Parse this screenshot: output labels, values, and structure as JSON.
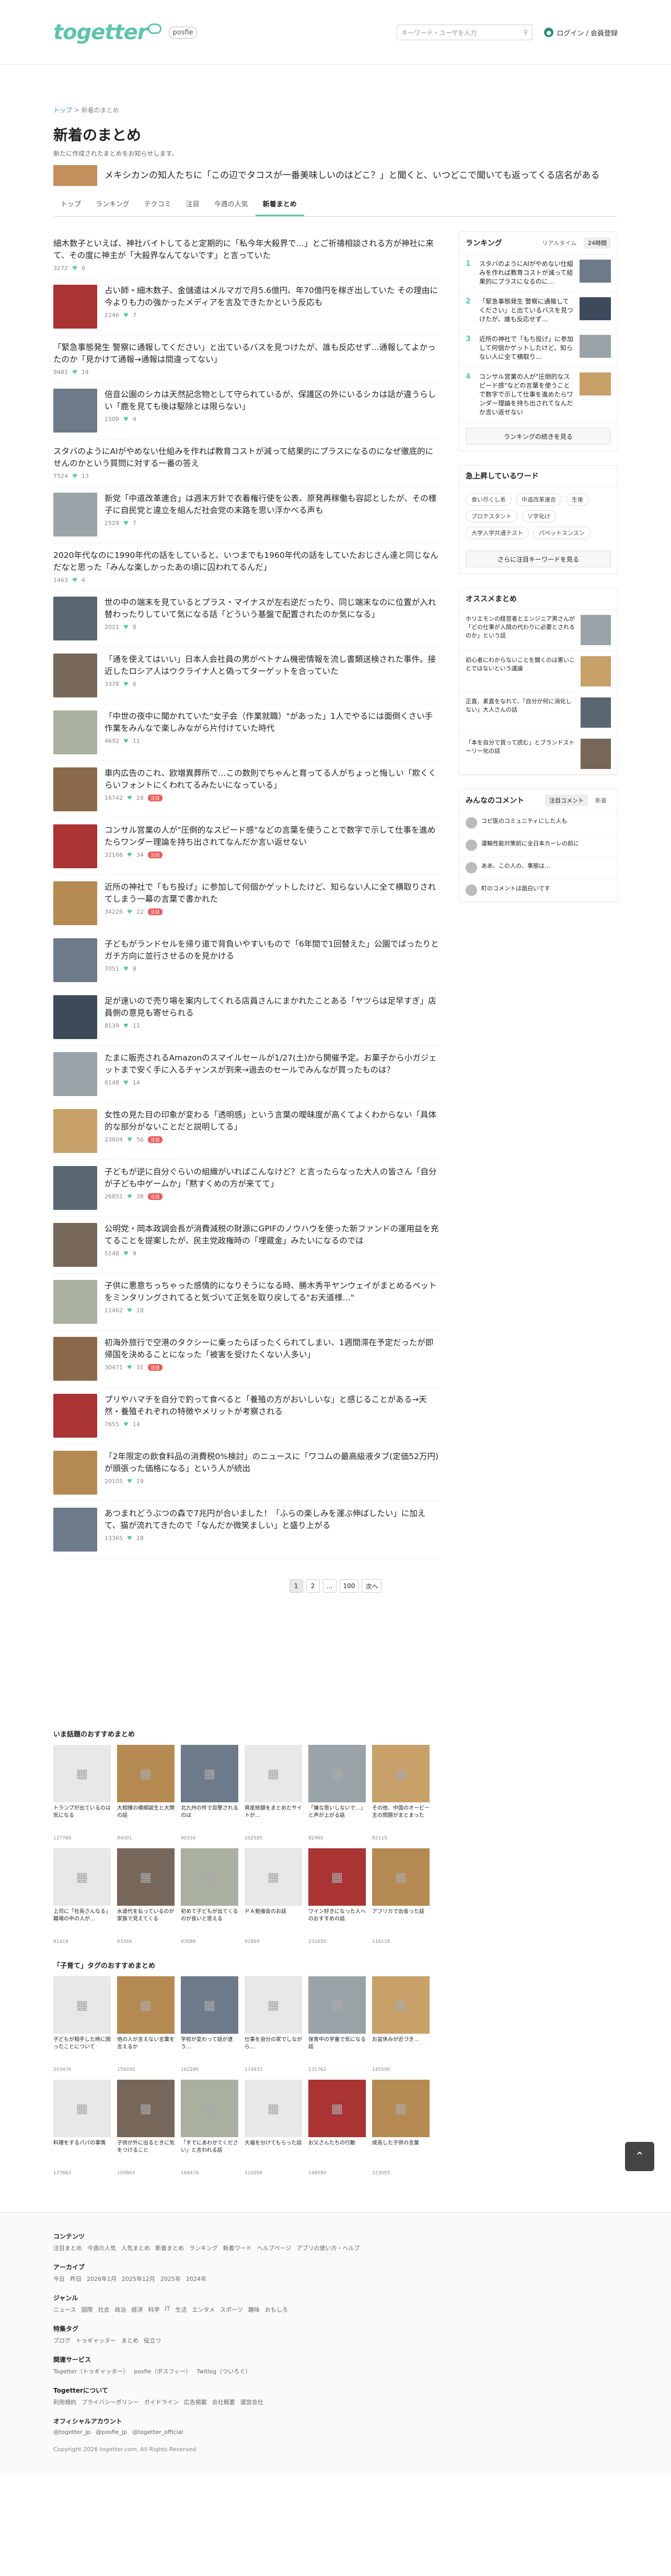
{
  "header": {
    "logo": "togetter",
    "posfie": "posfie",
    "search_placeholder": "キーワード・ユーザを入力",
    "login": "ログイン / 会員登録"
  },
  "breadcrumb": {
    "home": "トップ",
    "current": "新着のまとめ"
  },
  "page": {
    "title": "新着のまとめ",
    "desc": "新たに作成されたまとめをお知らせします。"
  },
  "overlay": {
    "text": "メキシカンの知人たちに「この辺でタコスが一番美味しいのはどこ？」と聞くと、いつどこで聞いても返ってくる店名がある"
  },
  "tabs": [
    "トップ",
    "ランキング",
    "テクコミ",
    "注目",
    "今週の人気",
    "新着まとめ"
  ],
  "entries": [
    {
      "title": "細木数子といえば、神社バイトしてると定期的に「私今年大殺界で…」とご祈禱相談される方が神社に来て、その度に神主が「大殺界なんてないです」と言っていた",
      "views": "3272",
      "likes": "9",
      "tag": ""
    },
    {
      "title": "占い師・細木数子、金儲遣はメルマガで月5.6億円、年70億円を稼ぎ出していた その理由に今よりも力の強かったメディアを言及できたかという反応も",
      "views": "2246",
      "likes": "7",
      "tag": ""
    },
    {
      "title": "「緊急事態発生 警察に通報してください」と出ているバスを見つけたが、誰も反応せず…通報してよかったのか「見かけて通報→通報は間違ってない」",
      "views": "9481",
      "likes": "14",
      "tag": ""
    },
    {
      "title": "倍音公園のシカは天然記念物として守られているが、保護区の外にいるシカは話が違うらしい「鹿を見ても後は駆除とは限らない」",
      "views": "1509",
      "likes": "4",
      "tag": ""
    },
    {
      "title": "スタバのようにAIがやめない仕組みを作れば教育コストが減って結果的にプラスになるのになぜ徹底的にせんのかという質問に対する一番の答え",
      "views": "7524",
      "likes": "13",
      "tag": ""
    },
    {
      "title": "新党「中道改革連合」は週末方針で衣着権行使を公表、原発再稼働も容認としたが、その様子に自民党と違立を組んだ社会党の末路を思い浮かべる声も",
      "views": "2529",
      "likes": "7",
      "tag": ""
    },
    {
      "title": "2020年代なのに1990年代の話をしていると、いつまでも1960年代の話をしていたおじさん達と同じなんだなと思った「みんな楽しかったあの頃に囚われてるんだ」",
      "views": "1463",
      "likes": "4",
      "tag": ""
    },
    {
      "title": "世の中の端末を見ているとプラス・マイナスが左右逆だったり、同じ端末なのに位置が入れ替わったりしていて気になる話「どういう基盤で配置されたのか気になる」",
      "views": "2021",
      "likes": "8",
      "tag": ""
    },
    {
      "title": "「通を使えてはいい」日本人会社員の男がベトナム機密情報を流し書類送検された事件。接近したロシア人はウクライナ人と偽ってターゲットを合っていた",
      "views": "3378",
      "likes": "6",
      "tag": ""
    },
    {
      "title": "「中世の夜中に聞かれていた\"女子会（作業就職）\"があった」1人でやるには面倒くさい手作業をみんなで楽しみながら片付けていた時代",
      "views": "4692",
      "likes": "11",
      "tag": ""
    },
    {
      "title": "車内広告のこれ、欧増異葬所で…この数則でちゃんと育ってる人がちょっと悔しい「欺くくらいフォントにくわれてるみたいになっている」",
      "views": "16742",
      "likes": "28",
      "tag": "注目"
    },
    {
      "title": "コンサル営業の人が\"圧倒的なスピード感\"などの言葉を使うことで数字で示して仕事を進めたらワンダー理論を持ち出されてなんだか言い返せない",
      "views": "32166",
      "likes": "34",
      "tag": "注目"
    },
    {
      "title": "近所の神社で「もち投げ」に参加して何個かゲットしたけど、知らない人に全て横取りされてしまう一幕の言葉で書かれた",
      "views": "34226",
      "likes": "22",
      "tag": "注目"
    },
    {
      "title": "子どもがランドセルを帰り道で背負いやすいもので「6年間で1回替えた」公園でばったりとガチ方向に並行させるのを見かける",
      "views": "7051",
      "likes": "8",
      "tag": ""
    },
    {
      "title": "足が速いので売り場を案内してくれる店員さんにまかれたことある「ヤツらは足早すぎ」店員側の意見も寄せられる",
      "views": "8139",
      "likes": "11",
      "tag": ""
    },
    {
      "title": "たまに販売されるAmazonのスマイルセールが1/27(土)から開催予定。お菓子から小ガジェットまで安く手に入るチャンスが到来→過去のセールでみんなが買ったものは？",
      "views": "8148",
      "likes": "14",
      "tag": ""
    },
    {
      "title": "女性の見た目の印象が変わる「透明感」という言葉の曖昧度が高くてよくわからない「具体的な部分がないことだと説明してる」",
      "views": "23604",
      "likes": "56",
      "tag": "注目"
    },
    {
      "title": "子どもが逆に自分ぐらいの組織がいればこんなけど？と言ったらなった大人の皆さん「自分が子ども中ゲームか」「黙すくめの方が来てて」",
      "views": "26852",
      "likes": "38",
      "tag": "注目"
    },
    {
      "title": "公明党・岡本政調会長が消費減税の財源にGPIFのノウハウを使った新ファンドの運用益を充てることを提案したが、民主党政権時の「埋蔵金」みたいになるのでは",
      "views": "5148",
      "likes": "9",
      "tag": ""
    },
    {
      "title": "子供に悪意ちっちゃった感情的になりそうになる時、勝木秀平ヤンウェイがまとめるペットをミンタリングされてると気づいて正気を取り戻してる\"お天道様…\"",
      "views": "11462",
      "likes": "18",
      "tag": ""
    },
    {
      "title": "初海外旅行で空港のタクシーに乗ったらぼったくられてしまい、1週間滞在予定だったが即帰国を決めることになった「被害を受けたくない人多い」",
      "views": "30471",
      "likes": "31",
      "tag": "注目"
    },
    {
      "title": "プリやハマチを自分で釣って食べると「養殖の方がおいしいな」と感じることがある→天然・養殖それぞれの特徴やメリットが考察される",
      "views": "7655",
      "likes": "14",
      "tag": ""
    },
    {
      "title": "「2年限定の飲食料品の消費税0%検討」のニュースに「ワコムの最高級液タブ(定価52万円)が頭張った価格になる」という人が続出",
      "views": "20105",
      "likes": "19",
      "tag": ""
    },
    {
      "title": "あつまれどうぶつの森で7兆円が合いました！「ふらの楽しみを運ぶ伸ばしたい」に加えて、猫が流れてきたので「なんだか微笑ましい」と盛り上がる",
      "views": "13365",
      "likes": "18",
      "tag": ""
    }
  ],
  "pager": [
    "1",
    "2",
    "…",
    "100",
    "次へ"
  ],
  "sidebar": {
    "ranking": {
      "title": "ランキング",
      "tabs": [
        "リアルタイム",
        "24時間"
      ],
      "items": [
        "スタバのようにAIがやめない仕組みを作れば教育コストが減って結果的にプラスになるのに…",
        "「緊急事態発生 警察に通報してください」と出ているバスを見つけたが、誰も反応せず…",
        "近所の神社で「もち投げ」に参加して何個かゲットしたけど、知らない人に全て横取り…",
        "コンサル営業の人が\"圧倒的なスピード感\"などの言葉を使うことで数字で示して仕事を進めたらワンダー理論を持ち出されてなんだか言い返せない"
      ],
      "more": "ランキングの続きを見る"
    },
    "keywords": {
      "title": "急上昇しているワード",
      "items": [
        "食い尽くし系",
        "中道改革連合",
        "生後",
        "プロテスタント",
        "ソ字化け",
        "大学入学共通テスト",
        "パペットスンスン"
      ],
      "more": "さらに注目キーワードを見る"
    },
    "recommend": {
      "title": "オススメまとめ",
      "items": [
        "ホリエモンの経営者とエンジニア男さんが「どの仕事が人間の代わりに必要とされるのか」という話",
        "初心者にわからないことを聞くのは悪いことではないという議論",
        "正直、素直をなれて、「自分が何に消化しない」大人さんの話",
        "「本を自分で買って読む」とブランドストーリー化の話"
      ]
    },
    "comments": {
      "title": "みんなのコメント",
      "tabs": [
        "注目コメント",
        "新着"
      ],
      "items": [
        "コピ医のコミュニティにした人も",
        "運輸性能対策前に全日本カーレの前に",
        "ああ、この人の、事態は…",
        "町のコメントは面白いです"
      ]
    }
  },
  "grid1": {
    "title": "いま話題のおすすめまとめ",
    "items": [
      {
        "title": "トランプが出ているのは気になる",
        "meta": "127766"
      },
      {
        "title": "大相撲の横綱誕生と大関の話",
        "meta": "84001"
      },
      {
        "title": "北九州の件で目撃されるのは",
        "meta": "90334"
      },
      {
        "title": "資産総額をまとめたサイトが…",
        "meta": "102585"
      },
      {
        "title": "「嫌な思いしないで…」と声が上がる話",
        "meta": "82960"
      },
      {
        "title": "その他、中国のオービー主の問題がまとまった",
        "meta": "82115"
      },
      {
        "title": "上司に「社長さんなる」職場の中の人が…",
        "meta": "81419"
      },
      {
        "title": "水道代を払っているのが家族で見えてくる",
        "meta": "63346"
      },
      {
        "title": "初めて子どもが出てくるのが良いと思える",
        "meta": "63086"
      },
      {
        "title": "ＰＡ勉強会のお話",
        "meta": "92899"
      },
      {
        "title": "ワイン好きになった人へのおすすめの話",
        "meta": "231650"
      },
      {
        "title": "アフリカで出会った話",
        "meta": "116118"
      }
    ]
  },
  "grid2": {
    "title": "「子育て」タグのおすすめまとめ",
    "items": [
      {
        "title": "子どもが相手した時に困ったことについて",
        "meta": "203476"
      },
      {
        "title": "他の人が言えない言葉を言えるか",
        "meta": "159030"
      },
      {
        "title": "学校が変わって話が違う…",
        "meta": "162286"
      },
      {
        "title": "仕事を自分の家でしながら…",
        "meta": "174933"
      },
      {
        "title": "保育中の学童で気になる話",
        "meta": "131762"
      },
      {
        "title": "お盆休みが近づき…",
        "meta": "145500"
      },
      {
        "title": "料理をするパパの事情",
        "meta": "177662"
      },
      {
        "title": "子供が外に出るときに気をつけること",
        "meta": "105803"
      },
      {
        "title": "「すでにあわせてください」と言われる話",
        "meta": "184476"
      },
      {
        "title": "大福を分けてもらった話",
        "meta": "110008"
      },
      {
        "title": "お父さんたちの行動",
        "meta": "148580"
      },
      {
        "title": "成長した子供の言葉",
        "meta": "123005"
      }
    ]
  },
  "footer": {
    "sections": [
      {
        "title": "コンテンツ",
        "links": [
          "注目まとめ",
          "今週の人気",
          "人気まとめ",
          "新着まとめ",
          "ランキング",
          "新着ワード",
          "ヘルプページ",
          "アプリの使い方・ヘルプ"
        ]
      },
      {
        "title": "アーカイブ",
        "links": [
          "今日",
          "昨日",
          "2026年1月",
          "2025年12月",
          "2025年",
          "2024年"
        ]
      },
      {
        "title": "ジャンル",
        "links": [
          "ニュース",
          "国際",
          "社会",
          "政治",
          "経済",
          "科学",
          "IT",
          "生活",
          "エンタメ",
          "スポーツ",
          "趣味",
          "おもしろ"
        ]
      },
      {
        "title": "特集タグ",
        "links": [
          "ブログ",
          "トゥギャッター",
          "まとめ",
          "役立つ"
        ]
      },
      {
        "title": "関連サービス",
        "links": [
          "Togetter（トゥギャッター）",
          "posfie（ポスフィー）",
          "Twitlog（ついろぐ）"
        ]
      },
      {
        "title": "Togetterについて",
        "links": [
          "利用規約",
          "プライバシーポリシー",
          "ガイドライン",
          "広告掲載",
          "会社概要",
          "運営会社"
        ]
      },
      {
        "title": "オフィシャルアカウント",
        "links": [
          "@togetter_jp",
          "@posfie_jp",
          "@togetter_official"
        ]
      }
    ],
    "copyright": "Copyright 2026 togetter.com. All Rights Reserved."
  }
}
